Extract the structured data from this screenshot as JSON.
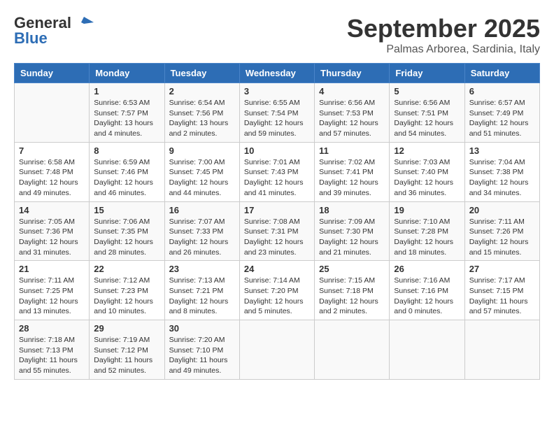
{
  "logo": {
    "line1": "General",
    "line2": "Blue"
  },
  "title": "September 2025",
  "subtitle": "Palmas Arborea, Sardinia, Italy",
  "days_of_week": [
    "Sunday",
    "Monday",
    "Tuesday",
    "Wednesday",
    "Thursday",
    "Friday",
    "Saturday"
  ],
  "weeks": [
    [
      {
        "day": "",
        "info": ""
      },
      {
        "day": "1",
        "info": "Sunrise: 6:53 AM\nSunset: 7:57 PM\nDaylight: 13 hours\nand 4 minutes."
      },
      {
        "day": "2",
        "info": "Sunrise: 6:54 AM\nSunset: 7:56 PM\nDaylight: 13 hours\nand 2 minutes."
      },
      {
        "day": "3",
        "info": "Sunrise: 6:55 AM\nSunset: 7:54 PM\nDaylight: 12 hours\nand 59 minutes."
      },
      {
        "day": "4",
        "info": "Sunrise: 6:56 AM\nSunset: 7:53 PM\nDaylight: 12 hours\nand 57 minutes."
      },
      {
        "day": "5",
        "info": "Sunrise: 6:56 AM\nSunset: 7:51 PM\nDaylight: 12 hours\nand 54 minutes."
      },
      {
        "day": "6",
        "info": "Sunrise: 6:57 AM\nSunset: 7:49 PM\nDaylight: 12 hours\nand 51 minutes."
      }
    ],
    [
      {
        "day": "7",
        "info": "Sunrise: 6:58 AM\nSunset: 7:48 PM\nDaylight: 12 hours\nand 49 minutes."
      },
      {
        "day": "8",
        "info": "Sunrise: 6:59 AM\nSunset: 7:46 PM\nDaylight: 12 hours\nand 46 minutes."
      },
      {
        "day": "9",
        "info": "Sunrise: 7:00 AM\nSunset: 7:45 PM\nDaylight: 12 hours\nand 44 minutes."
      },
      {
        "day": "10",
        "info": "Sunrise: 7:01 AM\nSunset: 7:43 PM\nDaylight: 12 hours\nand 41 minutes."
      },
      {
        "day": "11",
        "info": "Sunrise: 7:02 AM\nSunset: 7:41 PM\nDaylight: 12 hours\nand 39 minutes."
      },
      {
        "day": "12",
        "info": "Sunrise: 7:03 AM\nSunset: 7:40 PM\nDaylight: 12 hours\nand 36 minutes."
      },
      {
        "day": "13",
        "info": "Sunrise: 7:04 AM\nSunset: 7:38 PM\nDaylight: 12 hours\nand 34 minutes."
      }
    ],
    [
      {
        "day": "14",
        "info": "Sunrise: 7:05 AM\nSunset: 7:36 PM\nDaylight: 12 hours\nand 31 minutes."
      },
      {
        "day": "15",
        "info": "Sunrise: 7:06 AM\nSunset: 7:35 PM\nDaylight: 12 hours\nand 28 minutes."
      },
      {
        "day": "16",
        "info": "Sunrise: 7:07 AM\nSunset: 7:33 PM\nDaylight: 12 hours\nand 26 minutes."
      },
      {
        "day": "17",
        "info": "Sunrise: 7:08 AM\nSunset: 7:31 PM\nDaylight: 12 hours\nand 23 minutes."
      },
      {
        "day": "18",
        "info": "Sunrise: 7:09 AM\nSunset: 7:30 PM\nDaylight: 12 hours\nand 21 minutes."
      },
      {
        "day": "19",
        "info": "Sunrise: 7:10 AM\nSunset: 7:28 PM\nDaylight: 12 hours\nand 18 minutes."
      },
      {
        "day": "20",
        "info": "Sunrise: 7:11 AM\nSunset: 7:26 PM\nDaylight: 12 hours\nand 15 minutes."
      }
    ],
    [
      {
        "day": "21",
        "info": "Sunrise: 7:11 AM\nSunset: 7:25 PM\nDaylight: 12 hours\nand 13 minutes."
      },
      {
        "day": "22",
        "info": "Sunrise: 7:12 AM\nSunset: 7:23 PM\nDaylight: 12 hours\nand 10 minutes."
      },
      {
        "day": "23",
        "info": "Sunrise: 7:13 AM\nSunset: 7:21 PM\nDaylight: 12 hours\nand 8 minutes."
      },
      {
        "day": "24",
        "info": "Sunrise: 7:14 AM\nSunset: 7:20 PM\nDaylight: 12 hours\nand 5 minutes."
      },
      {
        "day": "25",
        "info": "Sunrise: 7:15 AM\nSunset: 7:18 PM\nDaylight: 12 hours\nand 2 minutes."
      },
      {
        "day": "26",
        "info": "Sunrise: 7:16 AM\nSunset: 7:16 PM\nDaylight: 12 hours\nand 0 minutes."
      },
      {
        "day": "27",
        "info": "Sunrise: 7:17 AM\nSunset: 7:15 PM\nDaylight: 11 hours\nand 57 minutes."
      }
    ],
    [
      {
        "day": "28",
        "info": "Sunrise: 7:18 AM\nSunset: 7:13 PM\nDaylight: 11 hours\nand 55 minutes."
      },
      {
        "day": "29",
        "info": "Sunrise: 7:19 AM\nSunset: 7:12 PM\nDaylight: 11 hours\nand 52 minutes."
      },
      {
        "day": "30",
        "info": "Sunrise: 7:20 AM\nSunset: 7:10 PM\nDaylight: 11 hours\nand 49 minutes."
      },
      {
        "day": "",
        "info": ""
      },
      {
        "day": "",
        "info": ""
      },
      {
        "day": "",
        "info": ""
      },
      {
        "day": "",
        "info": ""
      }
    ]
  ]
}
